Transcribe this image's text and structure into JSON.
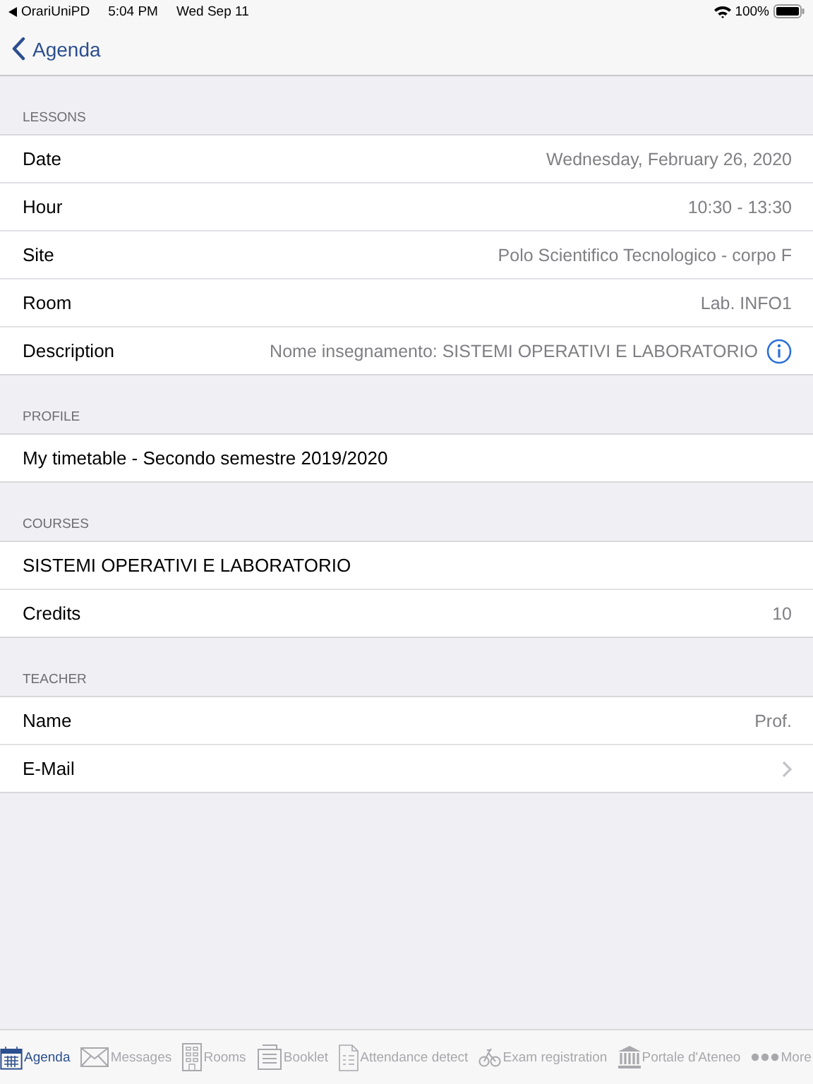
{
  "status_bar": {
    "back_app": "OrariUniPD",
    "time": "5:04 PM",
    "date": "Wed Sep 11",
    "battery": "100%"
  },
  "nav": {
    "back": "Agenda"
  },
  "sections": [
    {
      "title": "LESSONS",
      "rows": [
        {
          "kind": "value",
          "label": "Date",
          "value": "Wednesday, February 26, 2020"
        },
        {
          "kind": "value",
          "label": "Hour",
          "value": "10:30 - 13:30"
        },
        {
          "kind": "value",
          "label": "Site",
          "value": "Polo Scientifico Tecnologico - corpo F"
        },
        {
          "kind": "value",
          "label": "Room",
          "value": "Lab. INFO1"
        },
        {
          "kind": "info",
          "label": "Description",
          "value": "Nome insegnamento: SISTEMI OPERATIVI E LABORATORIO"
        }
      ]
    },
    {
      "title": "PROFILE",
      "rows": [
        {
          "kind": "plain",
          "label": "My timetable - Secondo semestre 2019/2020"
        }
      ]
    },
    {
      "title": "COURSES",
      "rows": [
        {
          "kind": "plain",
          "label": "SISTEMI OPERATIVI E LABORATORIO"
        },
        {
          "kind": "value",
          "label": "Credits",
          "value": "10"
        }
      ]
    },
    {
      "title": "TEACHER",
      "rows": [
        {
          "kind": "value",
          "label": "Name",
          "value": "Prof."
        },
        {
          "kind": "chevron",
          "label": "E-Mail"
        }
      ]
    }
  ],
  "tabs": [
    {
      "kind": "calendar",
      "label": "Agenda",
      "selected": true
    },
    {
      "kind": "envelope",
      "label": "Messages",
      "selected": false
    },
    {
      "kind": "building",
      "label": "Rooms",
      "selected": false
    },
    {
      "kind": "document",
      "label": "Booklet",
      "selected": false
    },
    {
      "kind": "list",
      "label": "Attendance detect",
      "selected": false
    },
    {
      "kind": "bike",
      "label": "Exam registration",
      "selected": false
    },
    {
      "kind": "bank",
      "label": "Portale d'Ateneo",
      "selected": false
    },
    {
      "kind": "dots",
      "label": "More",
      "selected": false
    }
  ]
}
